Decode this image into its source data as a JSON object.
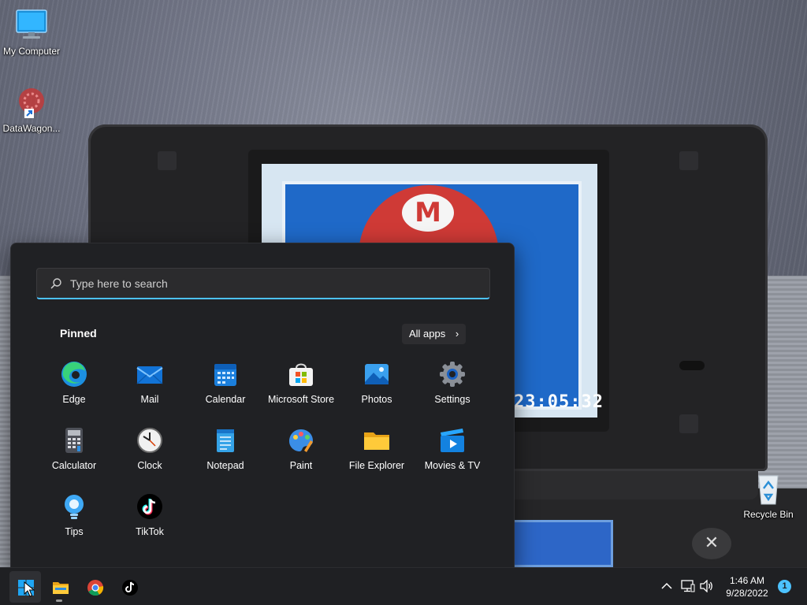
{
  "desktop": {
    "icons": [
      {
        "label": "My Computer",
        "icon": "monitor-icon"
      },
      {
        "label": "DataWagon...",
        "icon": "datawagon-shortcut-icon"
      },
      {
        "label": "Recycle Bin",
        "icon": "recycle-bin-icon"
      }
    ],
    "wallpaper": {
      "screen_time_text": "23:05:32"
    }
  },
  "start_menu": {
    "search": {
      "placeholder": "Type here to search",
      "value": "",
      "icon": "search-icon"
    },
    "pinned_title": "Pinned",
    "all_apps_label": "All apps",
    "pinned_apps": [
      {
        "label": "Edge",
        "icon": "edge-icon"
      },
      {
        "label": "Mail",
        "icon": "mail-icon"
      },
      {
        "label": "Calendar",
        "icon": "calendar-icon"
      },
      {
        "label": "Microsoft Store",
        "icon": "store-icon"
      },
      {
        "label": "Photos",
        "icon": "photos-icon"
      },
      {
        "label": "Settings",
        "icon": "settings-gear-icon"
      },
      {
        "label": "Calculator",
        "icon": "calculator-icon"
      },
      {
        "label": "Clock",
        "icon": "clock-icon"
      },
      {
        "label": "Notepad",
        "icon": "notepad-icon"
      },
      {
        "label": "Paint",
        "icon": "paint-icon"
      },
      {
        "label": "File Explorer",
        "icon": "folder-icon"
      },
      {
        "label": "Movies & TV",
        "icon": "movies-icon"
      },
      {
        "label": "Tips",
        "icon": "tips-lightbulb-icon"
      },
      {
        "label": "TikTok",
        "icon": "tiktok-icon"
      }
    ]
  },
  "taskbar": {
    "items": [
      {
        "name": "Start",
        "icon": "windows-start-icon",
        "active": true
      },
      {
        "name": "File Explorer",
        "icon": "folder-icon",
        "running": true
      },
      {
        "name": "Google Chrome",
        "icon": "chrome-icon"
      },
      {
        "name": "TikTok",
        "icon": "tiktok-icon"
      }
    ],
    "tray": {
      "icons": [
        "chevron-up-icon",
        "network-icon",
        "volume-icon"
      ],
      "time": "1:46 AM",
      "date": "9/28/2022",
      "notification_count": "1"
    }
  },
  "colors": {
    "accent": "#4cc2ff",
    "start_menu_bg": "#202124",
    "taskbar_bg": "#1f2023"
  }
}
